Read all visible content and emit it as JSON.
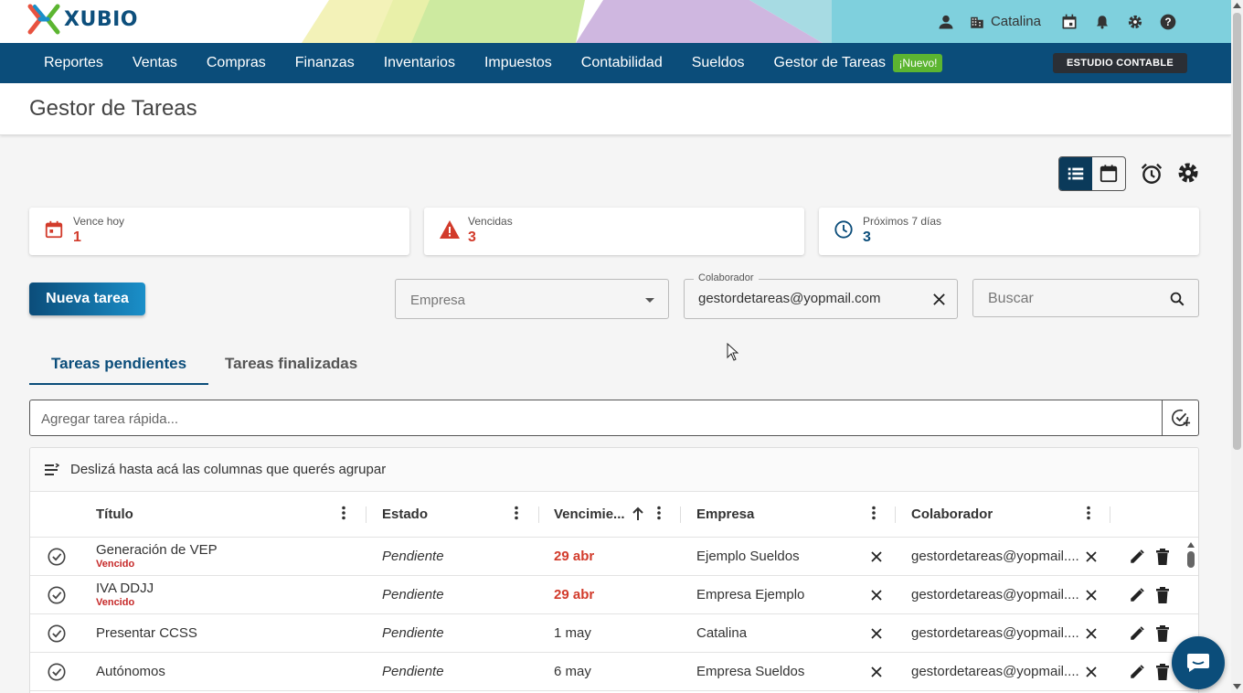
{
  "app": {
    "logo_text": "XUBIO"
  },
  "topbar": {
    "company": "Catalina"
  },
  "nav": {
    "items": [
      "Reportes",
      "Ventas",
      "Compras",
      "Finanzas",
      "Inventarios",
      "Impuestos",
      "Contabilidad",
      "Sueldos",
      "Gestor de Tareas"
    ],
    "new_badge": "¡Nuevo!",
    "estudio": "ESTUDIO CONTABLE"
  },
  "page": {
    "title": "Gestor de Tareas"
  },
  "cards": [
    {
      "label": "Vence hoy",
      "value": "1",
      "color": "#d23b2b"
    },
    {
      "label": "Vencidas",
      "value": "3",
      "color": "#d23b2b"
    },
    {
      "label": "Próximos 7 días",
      "value": "3",
      "color": "#0b4d7a"
    }
  ],
  "actions": {
    "new_task": "Nueva tarea",
    "empresa_placeholder": "Empresa",
    "colaborador_label": "Colaborador",
    "colaborador_value": "gestordetareas@yopmail.com",
    "search_placeholder": "Buscar"
  },
  "tabs": [
    "Tareas pendientes",
    "Tareas finalizadas"
  ],
  "quick_add": {
    "placeholder": "Agregar tarea rápida..."
  },
  "grid": {
    "group_hint": "Deslizá hasta acá las columnas que querés agrupar",
    "columns": [
      "Título",
      "Estado",
      "Vencimie...",
      "Empresa",
      "Colaborador"
    ],
    "rows": [
      {
        "title": "Generación de VEP",
        "overdue": "Vencido",
        "status": "Pendiente",
        "due": "29 abr",
        "due_overdue": true,
        "company": "Ejemplo Sueldos",
        "collaborator": "gestordetareas@yopmail...."
      },
      {
        "title": "IVA DDJJ",
        "overdue": "Vencido",
        "status": "Pendiente",
        "due": "29 abr",
        "due_overdue": true,
        "company": "Empresa Ejemplo",
        "collaborator": "gestordetareas@yopmail...."
      },
      {
        "title": "Presentar CCSS",
        "overdue": "",
        "status": "Pendiente",
        "due": "1 may",
        "due_overdue": false,
        "company": "Catalina",
        "collaborator": "gestordetareas@yopmail...."
      },
      {
        "title": "Autónomos",
        "overdue": "",
        "status": "Pendiente",
        "due": "6 may",
        "due_overdue": false,
        "company": "Empresa Sueldos",
        "collaborator": "gestordetareas@yopmail...."
      }
    ]
  },
  "colors": {
    "primary": "#0b4d7a",
    "danger": "#d23b2b",
    "badge": "#5cb531"
  }
}
